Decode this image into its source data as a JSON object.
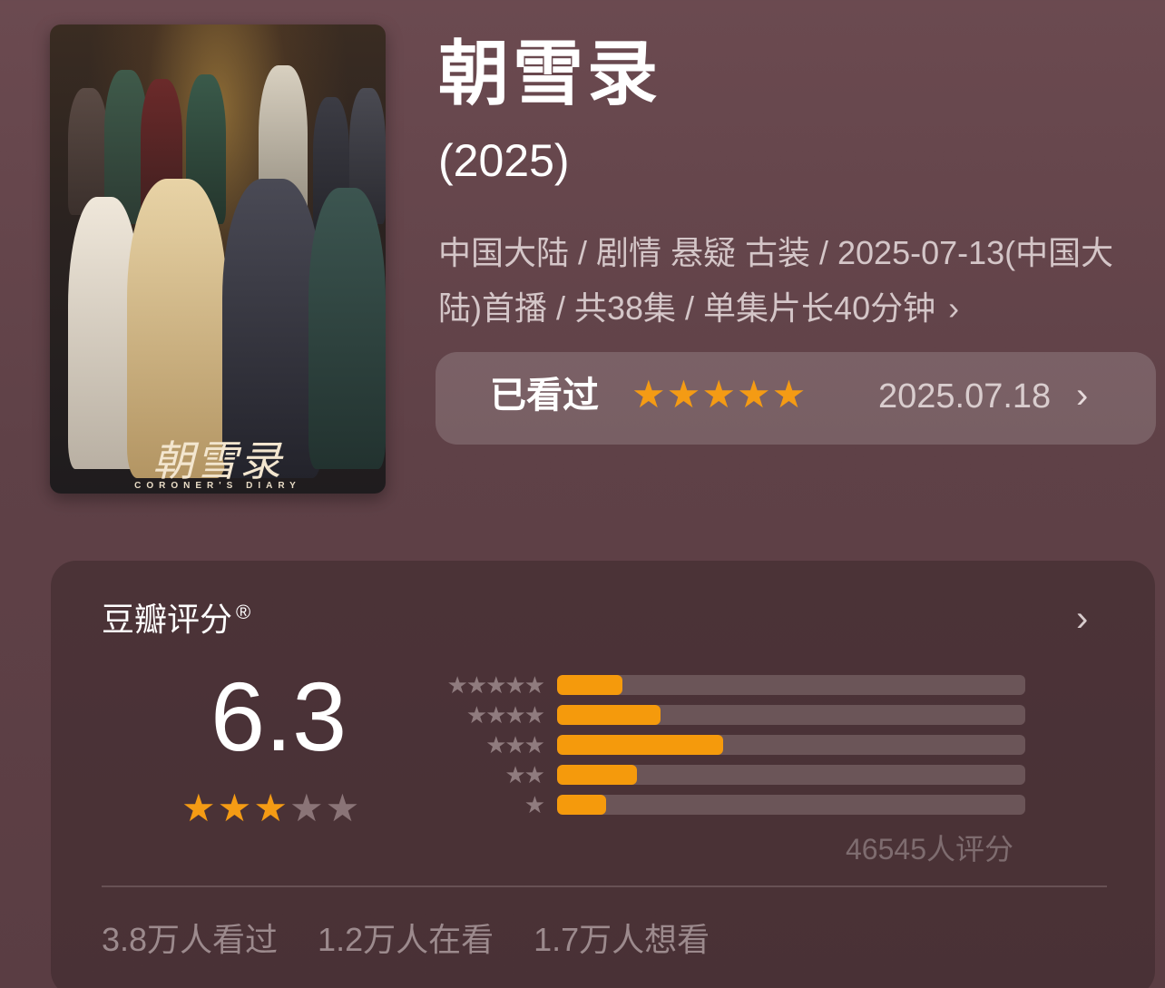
{
  "poster": {
    "title_art": "朝雪录",
    "subtitle_art": "CORONER'S DIARY"
  },
  "title": "朝雪录",
  "year": "(2025)",
  "meta": "中国大陆 / 剧情 悬疑 古装 / 2025-07-13(中国大陆)首播 / 共38集 / 单集片长40分钟",
  "watched": {
    "label": "已看过",
    "rating_stars": 5,
    "date": "2025.07.18"
  },
  "rating": {
    "title": "豆瓣评分",
    "registered_mark": "®",
    "score": "6.3",
    "stars_filled": 3,
    "stars_total": 5,
    "distribution": [
      {
        "stars": 5,
        "fraction": 0.14
      },
      {
        "stars": 4,
        "fraction": 0.22
      },
      {
        "stars": 3,
        "fraction": 0.355
      },
      {
        "stars": 2,
        "fraction": 0.17
      },
      {
        "stars": 1,
        "fraction": 0.105
      }
    ],
    "count_label": "46545人评分",
    "stats": [
      "3.8万人看过",
      "1.2万人在看",
      "1.7万人想看"
    ]
  },
  "colors": {
    "star_on": "#f49b14",
    "star_off": "#8a7477",
    "bar_fill": "#f59a0c"
  }
}
